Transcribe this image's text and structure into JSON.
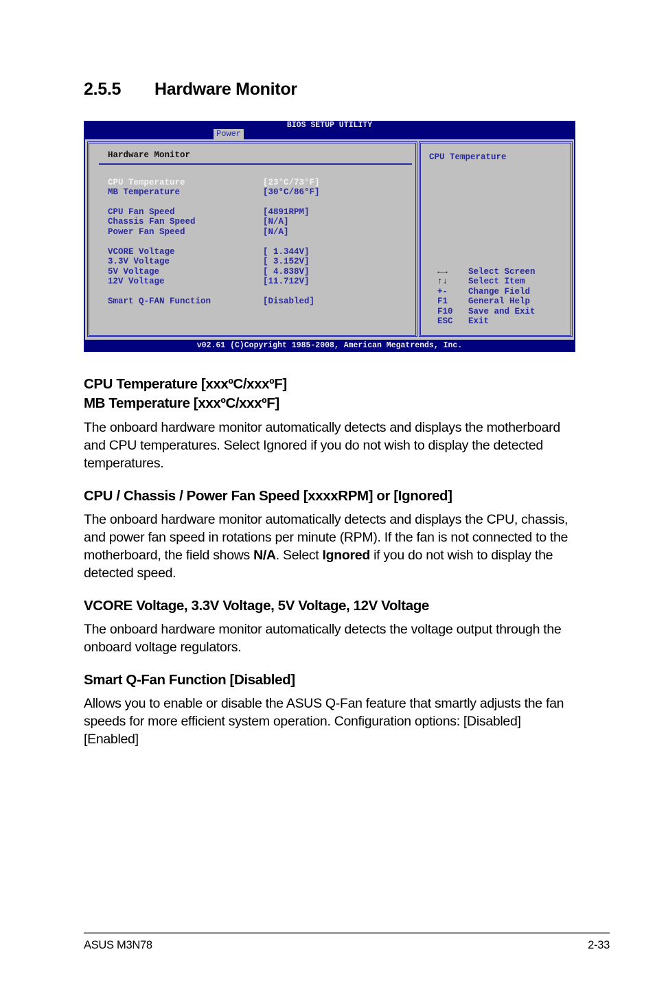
{
  "heading": {
    "number": "2.5.5",
    "title": "Hardware Monitor"
  },
  "bios": {
    "title": "BIOS SETUP UTILITY",
    "active_tab": "Power",
    "panel_title": "Hardware Monitor",
    "items": [
      {
        "label": "CPU Temperature",
        "value": "[23°C/73°F]",
        "selected": true
      },
      {
        "label": "MB Temperature",
        "value": "[30°C/86°F]",
        "selected": false
      },
      {
        "label": "CPU Fan Speed",
        "value": "[4891RPM]",
        "selected": false
      },
      {
        "label": "Chassis Fan Speed",
        "value": "[N/A]",
        "selected": false
      },
      {
        "label": "Power Fan Speed",
        "value": "[N/A]",
        "selected": false
      },
      {
        "label": "VCORE Voltage",
        "value": "[ 1.344V]",
        "selected": false
      },
      {
        "label": "3.3V Voltage",
        "value": "[ 3.152V]",
        "selected": false
      },
      {
        "label": "5V Voltage",
        "value": "[ 4.838V]",
        "selected": false
      },
      {
        "label": "12V Voltage",
        "value": "[11.712V]",
        "selected": false
      },
      {
        "label": "Smart Q-FAN Function",
        "value": "[Disabled]",
        "selected": false
      }
    ],
    "help_title": "CPU Temperature",
    "keys": [
      {
        "key": "←→",
        "icon": "left-right-arrows-icon",
        "desc": "Select Screen"
      },
      {
        "key": "↑↓",
        "icon": "up-down-arrows-icon",
        "desc": "Select Item"
      },
      {
        "key": "+-",
        "desc": "Change Field"
      },
      {
        "key": "F1",
        "desc": "General Help"
      },
      {
        "key": "F10",
        "desc": "Save and Exit"
      },
      {
        "key": "ESC",
        "desc": "Exit"
      }
    ],
    "footer": "v02.61 (C)Copyright 1985-2008, American Megatrends, Inc."
  },
  "sections": [
    {
      "heading_lines": [
        "CPU Temperature [xxxºC/xxxºF]",
        "MB Temperature [xxxºC/xxxºF]"
      ],
      "body": "The onboard hardware monitor automatically detects and displays the motherboard and CPU temperatures. Select Ignored if you do not wish to display the detected temperatures."
    },
    {
      "heading": "CPU / Chassis / Power Fan Speed [xxxxRPM] or [Ignored]",
      "body_parts": [
        "The onboard hardware monitor automatically detects and displays the CPU, chassis, and power fan speed in rotations per minute (RPM). If the fan is not connected to the motherboard, the field shows ",
        "N/A",
        ". Select ",
        "Ignored",
        " if you do not wish to display the detected speed."
      ]
    },
    {
      "heading": "VCORE Voltage, 3.3V Voltage, 5V Voltage, 12V Voltage",
      "body": "The onboard hardware monitor automatically detects the voltage output through the onboard voltage regulators."
    },
    {
      "heading": "Smart Q-Fan Function [Disabled]",
      "body": "Allows you to enable or disable the ASUS Q-Fan feature that smartly adjusts the fan speeds for more efficient system operation. Configuration options: [Disabled] [Enabled]"
    }
  ],
  "footer": {
    "left": "ASUS M3N78",
    "right": "2-33"
  }
}
